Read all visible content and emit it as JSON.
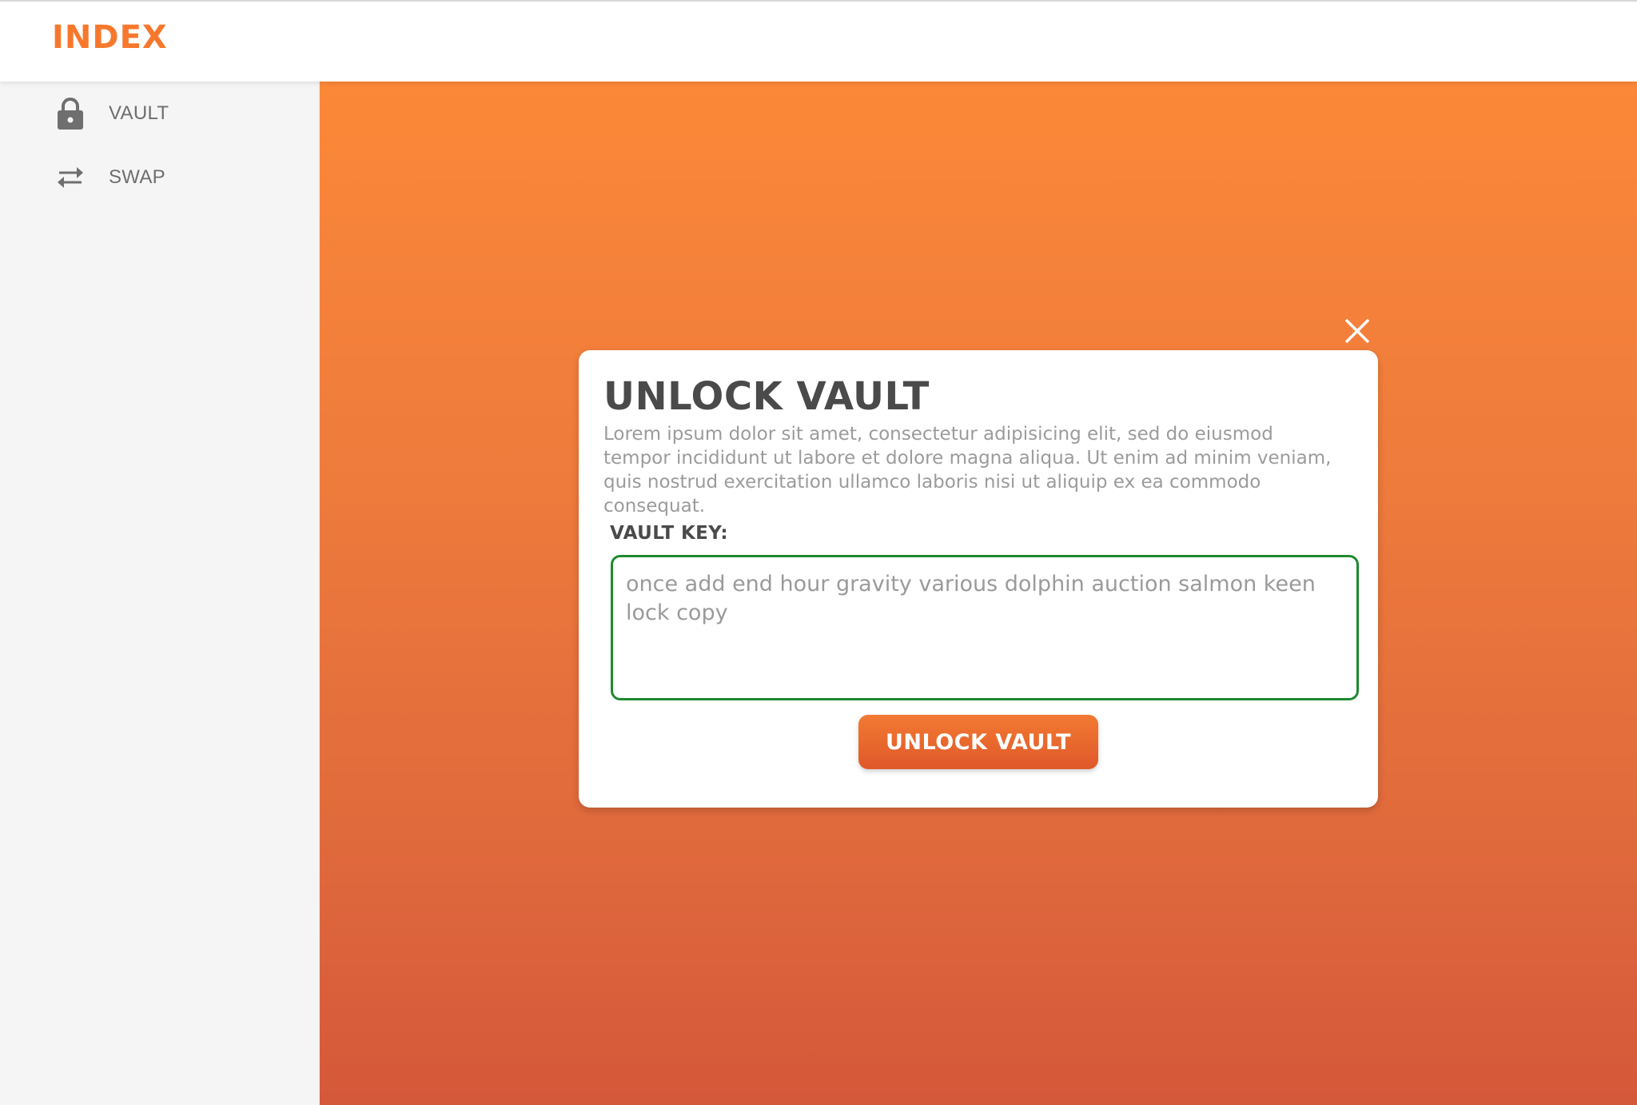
{
  "brand": {
    "logo_text": "INDEX",
    "accent_color": "#f7782c"
  },
  "sidebar": {
    "items": [
      {
        "label": "VAULT",
        "icon": "lock-icon"
      },
      {
        "label": "SWAP",
        "icon": "swap-arrows-icon"
      }
    ]
  },
  "main": {
    "background_gradient": [
      "#fb8838",
      "#d4583a"
    ]
  },
  "modal": {
    "close_icon": "close-icon",
    "title": "UNLOCK VAULT",
    "description": "Lorem ipsum dolor sit amet, consectetur adipisicing elit, sed do eiusmod tempor incididunt ut labore et dolore magna aliqua. Ut enim ad minim veniam, quis nostrud exercitation ullamco laboris nisi ut aliquip ex ea commodo consequat.",
    "key_label": "VAULT KEY:",
    "key_value": "once add end hour gravity various dolphin auction salmon keen lock copy",
    "key_border_color": "#1e8a2e",
    "button_label": "UNLOCK VAULT"
  }
}
